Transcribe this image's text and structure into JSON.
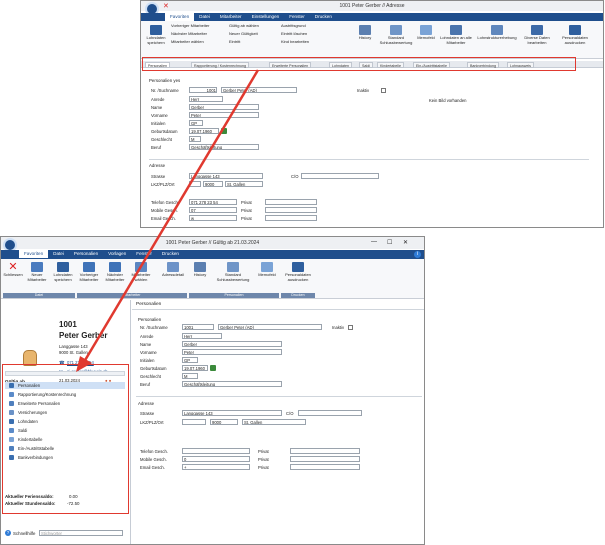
{
  "top_window": {
    "title": "1001 Peter Gerber // Adresse",
    "menu": [
      "Favoriten",
      "Datei",
      "Mitarbeiter",
      "Einstellungen",
      "Fenster",
      "Drucken"
    ],
    "ribbon_small": [
      "Lohndaten speichern",
      "Vorheriger Mitarbeiter",
      "Nächster Mitarbeiter",
      "Mitarbeiter wählen",
      "Gültig ab wählen",
      "Neuer Gültigkeit",
      "Eintritt",
      "Austrittsgrund",
      "Eintritt löschen",
      "Kind bearbeiten"
    ],
    "ribbon_big": [
      "History",
      "Standard Schlussbewertung",
      "Memofeld",
      "Lohndaten an alle Mitarbeiter",
      "Lohnstrukturerhebung",
      "Diverse Daten bearbeiten",
      "Personaldaten ausdrucken"
    ],
    "tabs": [
      "Personalien",
      "Rapportierung / Kostenrechnung",
      "Erweiterte Personalien",
      "Lohndaten",
      "Saldi",
      "Kindertabelle",
      "Ein-/Austrittstabelle",
      "Bankverbindung",
      "Lohnausweis"
    ],
    "section_personalien": "Personalien yes",
    "fields": {
      "nr_label": "Nr. /Suchname",
      "nr": "1001",
      "suchname": "Gerber Peter (AD)",
      "inaktiv": "Inaktiv",
      "anrede_label": "Anrede",
      "anrede": "Herr",
      "name_label": "Name",
      "name": "Gerber",
      "vorname_label": "Vorname",
      "vorname": "Peter",
      "initialen_label": "Initialen",
      "initialen": "GP",
      "geburt_label": "Geburtsdatum",
      "geburt": "19.07.1960",
      "geschlecht_label": "Geschlecht",
      "geschlecht": "M",
      "beruf_label": "Beruf",
      "beruf": "Geschäftsleitung"
    },
    "no_image": "Kein Bild vorhanden",
    "section_adresse": "Adresse",
    "adresse": {
      "strasse_label": "Strasse",
      "strasse": "Langgasse 143",
      "co": "C/O",
      "plz_label": "LKZ/PLZ/Ort",
      "plz": "9000",
      "ort": "St. Gallen"
    },
    "contact": {
      "tel_label": "Telefon Gesch.",
      "tel": "071 278 23 54",
      "privat": "Privat",
      "mobile_label": "Mobile Gesch.",
      "mobile": "07",
      "email_label": "Email Gesch.",
      "email": "w"
    }
  },
  "bottom_window": {
    "title": "1001 Peter Gerber // Gültig ab 21.03.2024",
    "menu": [
      "Favoriten",
      "Datei",
      "Personalien",
      "Vorlagen",
      "Fenster",
      "Drucken"
    ],
    "ribbon": [
      "Schliessen",
      "Neuer Mitarbeiter",
      "Lohndaten speichern",
      "Vorheriger Mitarbeiter",
      "Nächster Mitarbeiter",
      "Mitarbeiter wählen",
      "Adressdetail",
      "History",
      "Standard Schlussbewertung",
      "Memofeld",
      "Personaldaten ausdrucken"
    ],
    "groups": [
      "Datei",
      "Mitarbeiter",
      "Personalien",
      "Drucken"
    ],
    "profile": {
      "id": "1001",
      "name": "Peter Gerber",
      "street": "Langgasse 143",
      "city": "9000 St. Gallen",
      "phone": "071 278 23 54",
      "email": "pi.gerber@bluewin.ch",
      "date": "21.03.2024",
      "label": "Gültig ab"
    },
    "nav": [
      "Personalien",
      "Rapportierung/Kostenrechnung",
      "Erweiterte Personalien",
      "Versicherungen",
      "Lohndaten",
      "Saldi",
      "Kindertabelle",
      "Ein-/Austrittstabelle",
      "Bankverbindungen"
    ],
    "ferien_label": "Aktueller Ferienssaldo:",
    "ferien": "0.00",
    "stunden_label": "Aktueller Stundensaldo:",
    "stunden": "-72.50",
    "help_label": "Schnellhilfe",
    "help_placeholder": "Stichworter",
    "panel_title": "Personalien",
    "section_personalien": "Personalien",
    "fields": {
      "nr_label": "Nr. /Suchname",
      "nr": "1001",
      "suchname": "Gerber Peter (AD)",
      "inaktiv": "Inaktiv",
      "anrede_label": "Anrede",
      "anrede": "Herr",
      "name_label": "Name",
      "name": "Gerber",
      "vorname_label": "Vorname",
      "vorname": "Peter",
      "initialen_label": "Initialen",
      "initialen": "GP",
      "geburt_label": "Geburtsdatum",
      "geburt": "19.07.1960",
      "geschlecht_label": "Geschlecht",
      "geschlecht": "M",
      "beruf_label": "Beruf",
      "beruf": "Geschäftsleitung"
    },
    "section_adresse": "Adresse",
    "adresse": {
      "strasse_label": "Strasse",
      "strasse": "Langgasse 143",
      "co": "C/O",
      "plz_label": "LKZ/PLZ/Ort",
      "plz": "9000",
      "ort": "St. Gallen"
    },
    "contact": {
      "tel_label": "Telefon Gesch.",
      "privat": "Privat",
      "mobile_label": "Mobile Gesch.",
      "mobile": "0",
      "email_label": "Email Gesch.",
      "email": "+"
    }
  },
  "colors": {
    "accent": "#1f4e8c",
    "highlight": "#e0392f",
    "nav_selected": "#cfe0f5"
  }
}
